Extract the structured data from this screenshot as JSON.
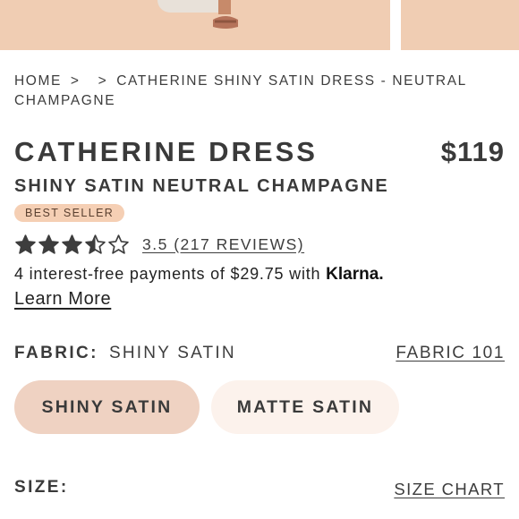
{
  "colors": {
    "hero_background": "#f0cdb3",
    "badge_background": "#f5cfb4",
    "selected_option": "#efd2c2",
    "unselected_option": "#fcf2ec",
    "text": "#3a3a3a",
    "star": "#3d3d3d"
  },
  "breadcrumb": {
    "home": "HOME",
    "separator_1": ">",
    "separator_2": ">",
    "current": "CATHERINE SHINY SATIN DRESS - NEUTRAL CHAMPAGNE"
  },
  "product": {
    "title": "CATHERINE DRESS",
    "price": "$119",
    "subtitle": "SHINY SATIN NEUTRAL CHAMPAGNE",
    "badge": "BEST SELLER"
  },
  "rating": {
    "value": 3.5,
    "max": 5,
    "reviews_label": "3.5 (217 REVIEWS)"
  },
  "payments": {
    "text": "4 interest-free payments of $29.75 with ",
    "provider": "Klarna",
    "period": ".",
    "learn_more": "Learn More"
  },
  "fabric": {
    "label": "FABRIC:",
    "selected": "SHINY SATIN",
    "guide_link": "FABRIC 101",
    "options": [
      {
        "label": "SHINY SATIN",
        "selected": true
      },
      {
        "label": "MATTE SATIN",
        "selected": false
      }
    ]
  },
  "size": {
    "label": "SIZE:",
    "chart_link": "SIZE CHART"
  }
}
